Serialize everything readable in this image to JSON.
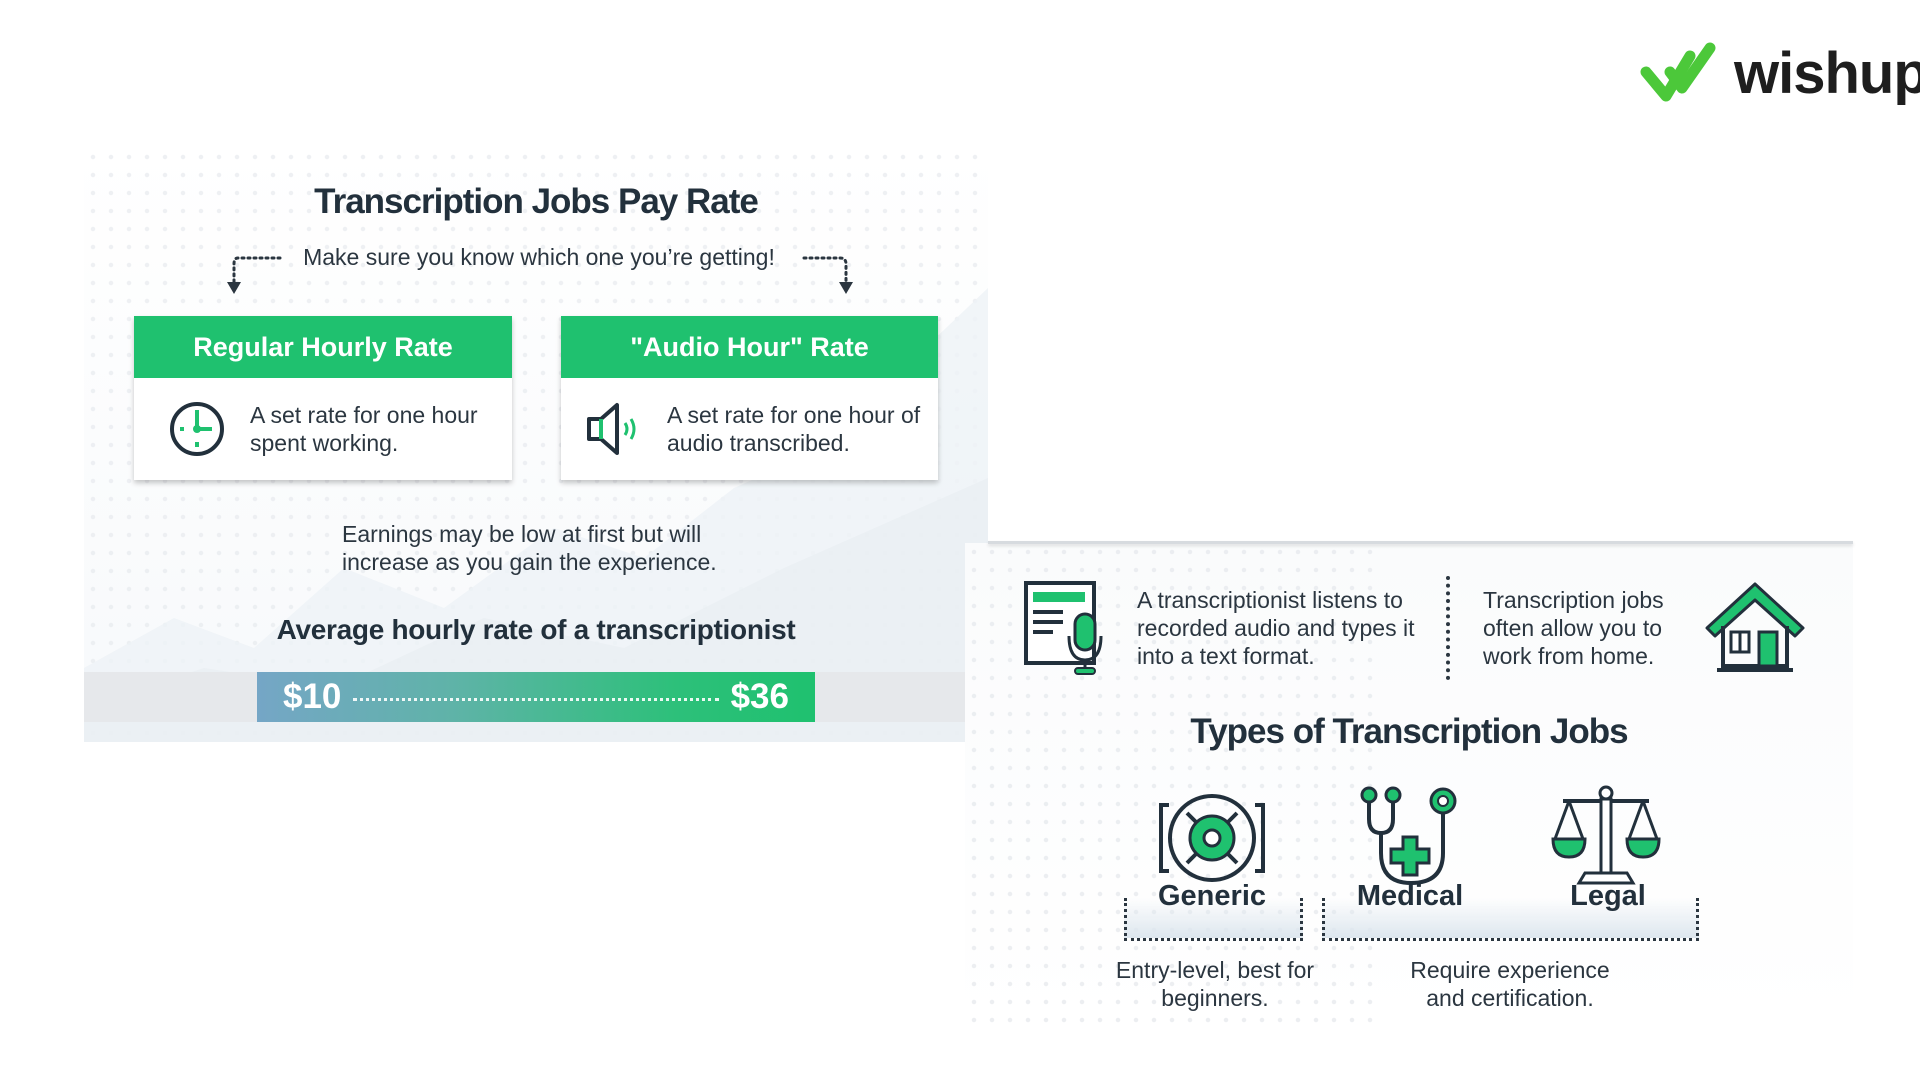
{
  "brand": {
    "name": "wishup",
    "accent": "#4cc83a",
    "text_color": "#1e1e1e"
  },
  "colors": {
    "green": "#1fc16f",
    "dark": "#22303c",
    "bar_start": "#75a6c6",
    "bar_end": "#1fc16f"
  },
  "pay_rate": {
    "title": "Transcription Jobs Pay Rate",
    "subtitle": "Make sure you know which one you’re getting!",
    "cards": [
      {
        "heading": "Regular Hourly Rate",
        "icon": "clock-icon",
        "text": "A set rate for one hour spent working."
      },
      {
        "heading": "\"Audio Hour\" Rate",
        "icon": "speaker-icon",
        "text": "A set rate for one hour of audio transcribed."
      }
    ],
    "note": "Earnings may be low at first but will increase as you gain the experience.",
    "average": {
      "title": "Average hourly rate of a transcriptionist",
      "min": "$10",
      "max": "$36"
    }
  },
  "facts": [
    {
      "icon": "document-microphone-icon",
      "text": "A transcriptionist listens to recorded audio and types it into a text format."
    },
    {
      "icon": "house-icon",
      "text": "Transcription jobs often allow you to work from home."
    }
  ],
  "job_types": {
    "title": "Types of Transcription Jobs",
    "types": [
      {
        "label": "Generic",
        "icon": "speaker-target-icon"
      },
      {
        "label": "Medical",
        "icon": "stethoscope-icon"
      },
      {
        "label": "Legal",
        "icon": "scales-icon"
      }
    ],
    "groups": [
      {
        "applies_to": [
          "Generic"
        ],
        "text": "Entry-level, best for beginners."
      },
      {
        "applies_to": [
          "Medical",
          "Legal"
        ],
        "text": "Require experience and certification."
      }
    ]
  }
}
